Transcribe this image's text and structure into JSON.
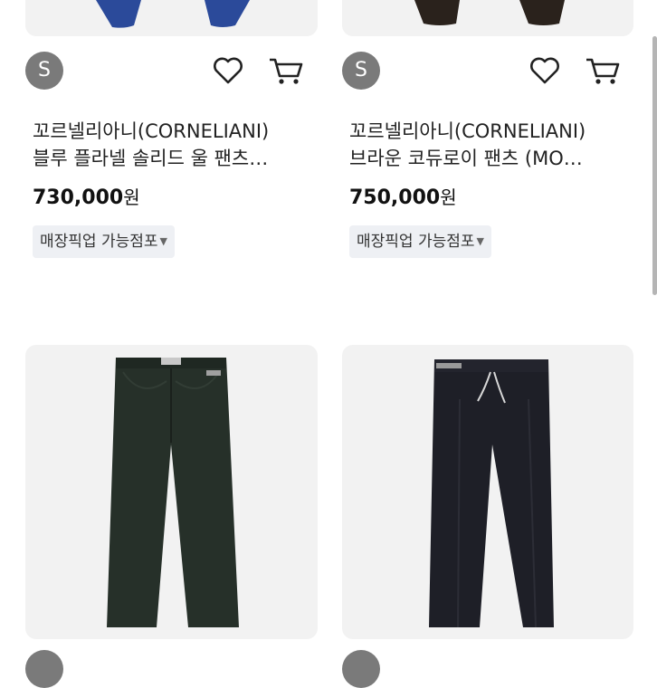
{
  "products": [
    {
      "seller_initial": "S",
      "title_line1": "꼬르넬리아니(CORNELIANI)",
      "title_line2": "블루 플라넬 솔리드 울 팬츠…",
      "price": "730,000",
      "currency": "원",
      "pickup_label": "매장픽업 가능점포",
      "image_icon": "navy-pants-image",
      "pants_color": "#2b4a9a"
    },
    {
      "seller_initial": "S",
      "title_line1": "꼬르넬리아니(CORNELIANI)",
      "title_line2": "브라운 코듀로이 팬츠 (MO…",
      "price": "750,000",
      "currency": "원",
      "pickup_label": "매장픽업 가능점포",
      "image_icon": "brown-pants-image",
      "pants_color": "#2a221c"
    },
    {
      "image_icon": "dark-green-jeans-image",
      "pants_color": "#263029"
    },
    {
      "image_icon": "black-drawstring-pants-image",
      "pants_color": "#1e1f27"
    }
  ],
  "icons": {
    "wishlist": "heart-icon",
    "cart": "cart-icon",
    "dropdown": "caret-down-icon"
  },
  "colors": {
    "badge": "#7a7a7a",
    "pickup_bg": "#eef0f4",
    "card_image_bg": "#f2f2f2"
  }
}
